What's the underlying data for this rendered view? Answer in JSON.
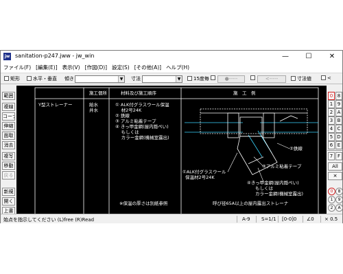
{
  "window": {
    "title": "sanitation-p247.jww - jw_win",
    "app_icon": "jw",
    "min": "—",
    "max": "☐",
    "close": "✕"
  },
  "menu": [
    "ファイル(F)",
    "[編集(E)]",
    "表示(V)",
    "[作図(D)]",
    "設定(S)",
    "[その他(A)]",
    "ヘルプ(H)"
  ],
  "toolbar": {
    "rect_label": "矩形",
    "hv_label": "水平・垂直",
    "tilt_label": "傾き",
    "tilt_value": "",
    "dim_label": "寸法",
    "dim_value": "",
    "deg15_label": "15度毎",
    "pt_button": "●-----",
    "arrow_button": "<-----",
    "dimval_label": "寸法値",
    "lt_button": "<"
  },
  "left_tools": [
    "範囲",
    "複線",
    "コーナー",
    "伸縮",
    "面取",
    "消去",
    "複写",
    "移動",
    "戻る",
    "新規",
    "開く",
    "上書"
  ],
  "right_tools": {
    "top_left": [
      "0",
      "1",
      "2",
      "3",
      "4",
      "5",
      "6",
      "7",
      "8",
      "9",
      "A",
      "B",
      "C",
      "D",
      "E",
      "F"
    ],
    "top_right": [
      "8",
      "9",
      "A",
      "B",
      "C",
      "D",
      "E",
      "F"
    ],
    "all_label": "All",
    "x_label": "✕",
    "bottom_left": [
      "0",
      "1",
      "2",
      "3"
    ],
    "bottom_right": [
      "8",
      "9",
      "A",
      "B"
    ]
  },
  "drawing": {
    "headers": {
      "location": "施工個所",
      "material": "材料及び施工順序",
      "example": "施　工　例"
    },
    "item": "Y型ストレーナー",
    "supply": [
      "給水",
      "井水"
    ],
    "steps": [
      "① ALK付グラスウール保温",
      "　 材2号24K",
      "② 鉄線",
      "③ アルミ粘着テープ",
      "④ きっ甲金網(屋内隠ぺい)",
      "　 もしくは",
      "　 カラー金網(機械室露出)"
    ],
    "note": "※保温の厚さは別紙参照",
    "callouts": {
      "wire": "②鉄線",
      "tape": "③アルミ粘着テープ",
      "glasswool": [
        "①ALK付グラスウール",
        "保温材2号24K"
      ],
      "mesh": [
        "④きっ甲金網(屋内隠ぺい)",
        "もしくは",
        "カラー金網(機械室露出)"
      ]
    },
    "caption": "呼び径65A以上の屋内露出ストレーナ"
  },
  "status": {
    "message": "始点を指示してください (L)free (R)Read",
    "paper": "A-9",
    "scale": "S=1/1",
    "layer": "[0-0]0",
    "angle": "∠0",
    "zoom": "× 0.5"
  },
  "colors": {
    "canvas_bg": "#000000",
    "line": "#ffffff",
    "pipe": "#3ad7ff",
    "accent_red": "#d32020"
  }
}
